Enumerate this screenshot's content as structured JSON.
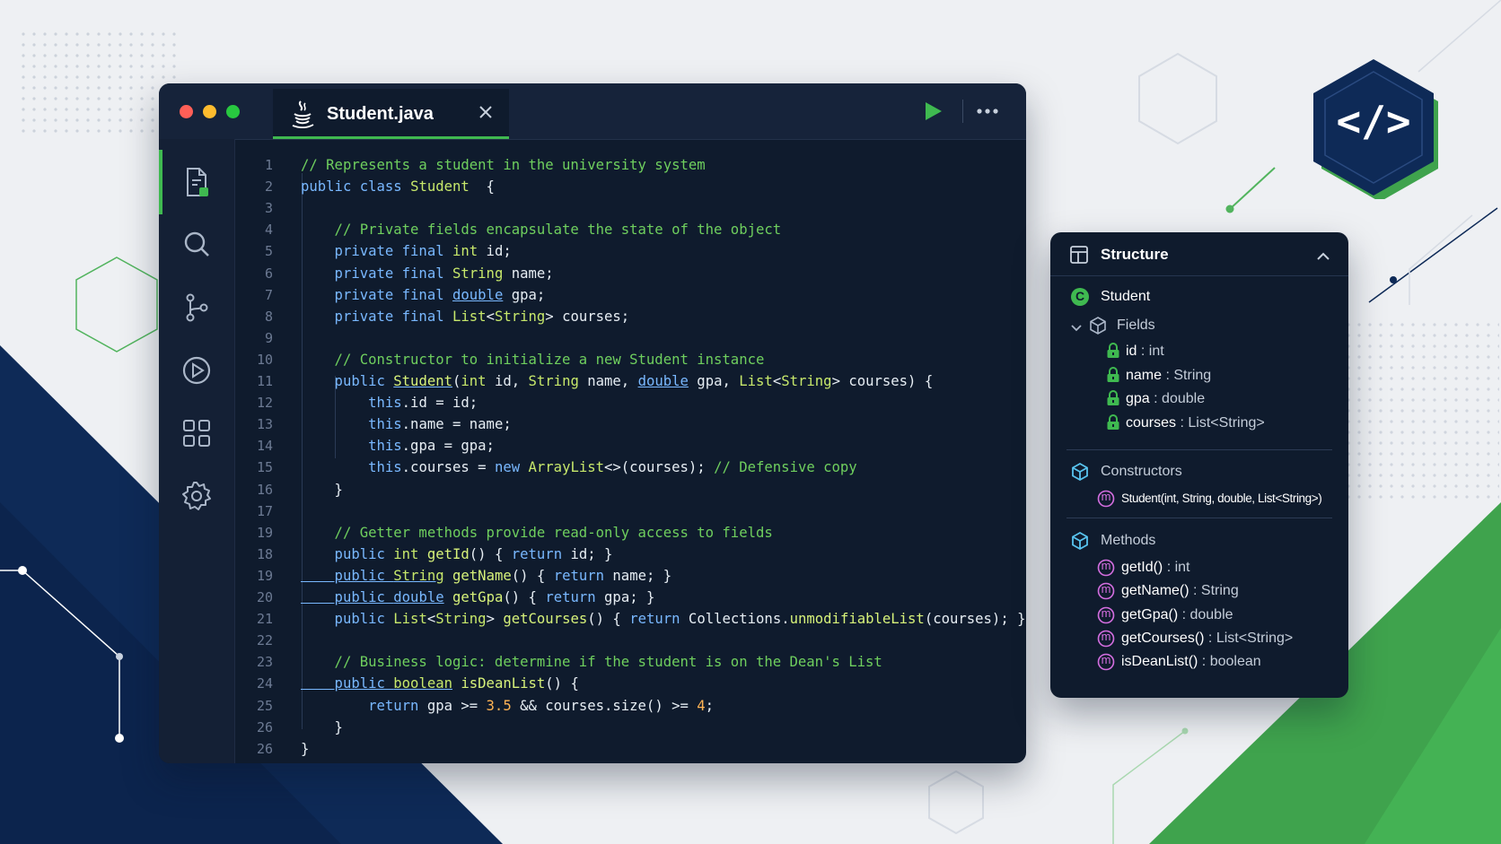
{
  "editor": {
    "tab": {
      "filename": "Student.java",
      "icon": "java-coffee-icon",
      "close_icon": "close-icon"
    },
    "toolbar": {
      "run_icon": "play-icon",
      "more_icon": "more-horizontal-icon"
    },
    "sidebar_icons": [
      "file-icon",
      "search-icon",
      "source-control-icon",
      "run-debug-icon",
      "extensions-icon",
      "settings-icon"
    ],
    "line_numbers": [
      "1",
      "2",
      "3",
      "4",
      "5",
      "6",
      "7",
      "8",
      "9",
      "10",
      "11",
      "12",
      "13",
      "14",
      "15",
      "16",
      "17",
      "19",
      "18",
      "19",
      "20",
      "21",
      "22",
      "23",
      "24",
      "25",
      "26",
      "26"
    ],
    "code_lines": [
      [
        [
          "cmt",
          "// Represents a student in the university system"
        ]
      ],
      [
        [
          "kw",
          "public class "
        ],
        [
          "ty",
          "Student"
        ],
        [
          "",
          "  {"
        ]
      ],
      [],
      [
        [
          "cmt",
          "    // Private fields encapsulate the state of the object"
        ]
      ],
      [
        [
          "kw",
          "    private final "
        ],
        [
          "ty",
          "int"
        ],
        [
          "",
          " id;"
        ]
      ],
      [
        [
          "kw",
          "    private final "
        ],
        [
          "ty",
          "String"
        ],
        [
          "",
          " name;"
        ]
      ],
      [
        [
          "kw",
          "    private final "
        ],
        [
          "kw ul",
          "double"
        ],
        [
          "",
          " gpa;"
        ]
      ],
      [
        [
          "kw",
          "    private final "
        ],
        [
          "ty",
          "List"
        ],
        [
          "",
          "<"
        ],
        [
          "ty",
          "String"
        ],
        [
          "",
          "> courses;"
        ]
      ],
      [],
      [
        [
          "cmt",
          "    // Constructor to initialize a new Student instance"
        ]
      ],
      [
        [
          "kw",
          "    public "
        ],
        [
          "fn ul",
          "Student"
        ],
        [
          "",
          "("
        ],
        [
          "ty",
          "int"
        ],
        [
          "",
          " id, "
        ],
        [
          "ty",
          "String"
        ],
        [
          "",
          " name, "
        ],
        [
          "kw ul",
          "double"
        ],
        [
          "",
          " gpa, "
        ],
        [
          "ty",
          "List"
        ],
        [
          "",
          "<"
        ],
        [
          "ty",
          "String"
        ],
        [
          "",
          "> courses) {"
        ]
      ],
      [
        [
          "kw",
          "        this"
        ],
        [
          "",
          ".id = id;"
        ]
      ],
      [
        [
          "kw",
          "        this"
        ],
        [
          "",
          ".name = name;"
        ]
      ],
      [
        [
          "kw",
          "        this"
        ],
        [
          "",
          ".gpa = gpa;"
        ]
      ],
      [
        [
          "kw",
          "        this"
        ],
        [
          "",
          ".courses = "
        ],
        [
          "kw",
          "new "
        ],
        [
          "ty",
          "ArrayList"
        ],
        [
          "",
          "<>(courses); "
        ],
        [
          "cmt",
          "// Defensive copy"
        ]
      ],
      [
        [
          "",
          "    }"
        ]
      ],
      [],
      [
        [
          "cmt",
          "    // Getter methods provide read-only access to fields"
        ]
      ],
      [
        [
          "kw",
          "    public "
        ],
        [
          "ty",
          "int "
        ],
        [
          "fn",
          "getId"
        ],
        [
          "",
          "() { "
        ],
        [
          "kw",
          "return"
        ],
        [
          "",
          " id; }"
        ]
      ],
      [
        [
          "kw ul",
          "    public "
        ],
        [
          "ty ul",
          "String"
        ],
        [
          "",
          " "
        ],
        [
          "fn",
          "getName"
        ],
        [
          "",
          "() { "
        ],
        [
          "kw",
          "return"
        ],
        [
          "",
          " name; }"
        ]
      ],
      [
        [
          "kw ul",
          "    public "
        ],
        [
          "kw ul",
          "double"
        ],
        [
          "",
          " "
        ],
        [
          "fn",
          "getGpa"
        ],
        [
          "",
          "() { "
        ],
        [
          "kw",
          "return"
        ],
        [
          "",
          " gpa; }"
        ]
      ],
      [
        [
          "kw",
          "    public "
        ],
        [
          "ty",
          "List"
        ],
        [
          "",
          "<"
        ],
        [
          "ty",
          "String"
        ],
        [
          "",
          "> "
        ],
        [
          "fn",
          "getCourses"
        ],
        [
          "",
          "() { "
        ],
        [
          "kw",
          "return"
        ],
        [
          "",
          " Collections."
        ],
        [
          "fn",
          "unmodifiableList"
        ],
        [
          "",
          "(courses); }"
        ]
      ],
      [],
      [
        [
          "cmt",
          "    // Business logic: determine if the student is on the Dean's List"
        ]
      ],
      [
        [
          "kw ul",
          "    public "
        ],
        [
          "ty ul",
          "boolean"
        ],
        [
          "",
          " "
        ],
        [
          "fn",
          "isDeanList"
        ],
        [
          "",
          "() {"
        ]
      ],
      [
        [
          "kw",
          "        return"
        ],
        [
          "",
          " gpa >= "
        ],
        [
          "num",
          "3.5"
        ],
        [
          "",
          " && courses.size() >= "
        ],
        [
          "num",
          "4"
        ],
        [
          "",
          ";"
        ]
      ],
      [
        [
          "",
          "    }"
        ]
      ],
      [
        [
          "",
          "}"
        ]
      ]
    ]
  },
  "structure": {
    "title": "Structure",
    "class_badge": "C",
    "class_name": "Student",
    "fields_label": "Fields",
    "fields": [
      {
        "name": "id",
        "type": " : int"
      },
      {
        "name": "name",
        "type": " : String"
      },
      {
        "name": "gpa",
        "type": " : double"
      },
      {
        "name": "courses",
        "type": " : List<String>"
      }
    ],
    "constructors_label": "Constructors",
    "constructors": [
      {
        "signature": "Student(int, String, double, List<String>)"
      }
    ],
    "methods_label": "Methods",
    "method_badge": "m",
    "methods": [
      {
        "name": "getId()",
        "type": " : int"
      },
      {
        "name": "getName()",
        "type": " : String"
      },
      {
        "name": "getGpa()",
        "type": " : double"
      },
      {
        "name": "getCourses()",
        "type": " : List<String>"
      },
      {
        "name": "isDeanList()",
        "type": " : boolean"
      }
    ]
  },
  "badge": {
    "text": "</>",
    "icon": "code-brackets-icon"
  },
  "colors": {
    "accent_green": "#3fb950",
    "navy": "#0f1b2d",
    "comment": "#6fcf5e",
    "keyword": "#79b8ff"
  }
}
